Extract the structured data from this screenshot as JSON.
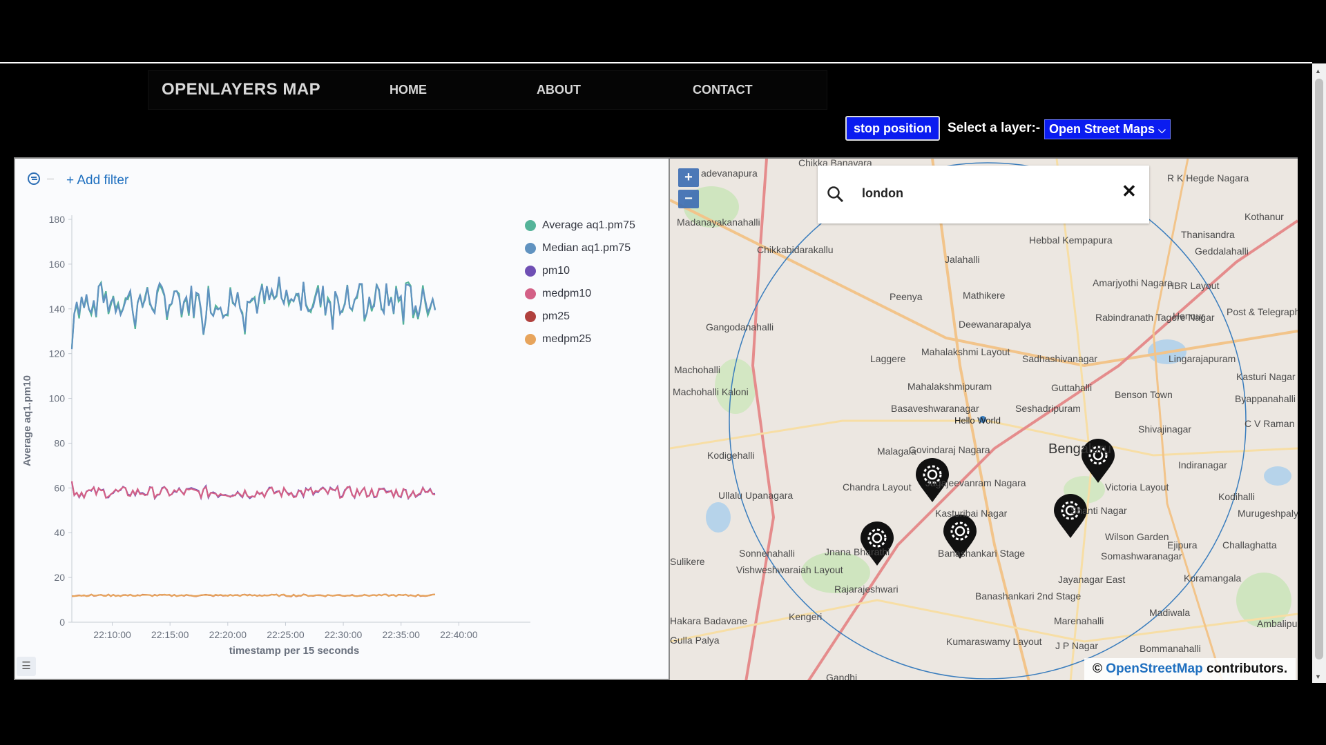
{
  "nav": {
    "brand": "OPENLAYERS MAP",
    "links": [
      "HOME",
      "ABOUT",
      "CONTACT"
    ]
  },
  "controls": {
    "stop_button": "stop position",
    "layer_label": "Select a layer:-",
    "layer_selected": "Open Street Maps",
    "layer_chevron": "⌵"
  },
  "dashboard": {
    "add_filter": "+ Add filter",
    "legend": [
      {
        "name": "Average aq1.pm75",
        "color": "#54b399"
      },
      {
        "name": "Median aq1.pm75",
        "color": "#6092c0"
      },
      {
        "name": "pm10",
        "color": "#6f4fb4"
      },
      {
        "name": "medpm10",
        "color": "#d36086"
      },
      {
        "name": "pm25",
        "color": "#b0413e"
      },
      {
        "name": "medpm25",
        "color": "#e7a45c"
      }
    ]
  },
  "chart_data": {
    "type": "line",
    "title": "",
    "xlabel": "timestamp per 15 seconds",
    "ylabel": "Average aq1.pm10",
    "ylim": [
      0,
      180
    ],
    "yticks": [
      0,
      20,
      40,
      60,
      80,
      100,
      120,
      140,
      160,
      180
    ],
    "xticks": [
      "22:10:00",
      "22:15:00",
      "22:20:00",
      "22:25:00",
      "22:30:00",
      "22:35:00",
      "22:40:00"
    ],
    "x_range": [
      "22:06:30",
      "22:45:00"
    ],
    "grid": false,
    "legend_position": "top-right",
    "series": [
      {
        "name": "Average aq1.pm75",
        "approx_mean": 144,
        "approx_range": [
          130,
          162
        ]
      },
      {
        "name": "Median aq1.pm75",
        "approx_mean": 144,
        "approx_range": [
          122,
          162
        ]
      },
      {
        "name": "pm10",
        "approx_mean": 58,
        "approx_range": [
          54,
          63
        ]
      },
      {
        "name": "medpm10",
        "approx_mean": 58,
        "approx_range": [
          54,
          63
        ]
      },
      {
        "name": "pm25",
        "approx_mean": 12,
        "approx_range": [
          11,
          13
        ]
      },
      {
        "name": "medpm25",
        "approx_mean": 12,
        "approx_range": [
          11,
          13
        ]
      }
    ]
  },
  "map": {
    "zoom_in": "+",
    "zoom_out": "−",
    "search_query": "london",
    "search_clear": "✕",
    "attribution_prefix": "©",
    "attribution_link": "OpenStreetMap",
    "attribution_suffix": "contributors.",
    "marker_label": "Hello World",
    "labels": [
      "Chikka Banavara",
      "R K Hegde Nagara",
      "adevanapura",
      "Madanayakanahalli",
      "Kothanur",
      "Thanisandra",
      "Geddalahalli",
      "Hebbal Kempapura",
      "Chikkabidarakallu",
      "Jalahalli",
      "Amarjyothi Nagara",
      "HBR Layout",
      "Peenya",
      "Mathikere",
      "Rabindranath Tagore Nagar",
      "Hennur",
      "Post & Telegraph Layout",
      "Gangodanahalli",
      "Deewanarapalya",
      "Mahalakshmi Layout",
      "Sadhashivanagar",
      "Lingarajapuram",
      "Laggere",
      "Machohalli",
      "Mahalakshmipuram",
      "Guttahalli",
      "Benson Town",
      "Kasturi Nagar",
      "Machohalli Kaloni",
      "Basaveshwaranagar",
      "Seshadripuram",
      "Byappanahalli",
      "Shivajinagar",
      "C V Raman Nagar",
      "Kodigehalli",
      "Malagala",
      "Govindaraj Nagara",
      "Bengaluru",
      "Indiranagar",
      "Ullalu Upanagara",
      "Chandra Layout",
      "Jagajeevanram Nagara",
      "Victoria Layout",
      "Kodihalli",
      "Murugeshpalya",
      "Kasturibai Nagar",
      "Shanti Nagar",
      "Sonnenahalli",
      "Jnana Bharathi",
      "Banashankari Stage",
      "Wilson Garden",
      "Ejipura",
      "Challaghatta",
      "Sulikere",
      "Vishweshwaraiah Layout",
      "Somashwaranagar",
      "Koramangala",
      "Rajarajeshwari",
      "Banashankari 2nd Stage",
      "Jayanagar East",
      "Kengeri",
      "Madiwala",
      "Hakara Badavane",
      "Marenahalli",
      "Ambalipura",
      "Kumaraswamy Layout",
      "J P Nagar",
      "Bommanahalli",
      "Gulla Palya",
      "Gandhi"
    ]
  }
}
